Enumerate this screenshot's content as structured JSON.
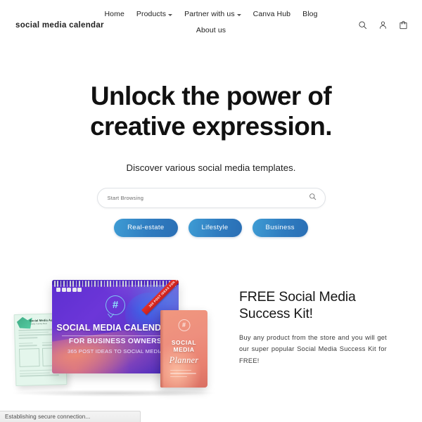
{
  "header": {
    "logo": "social media calendar",
    "nav_primary": [
      {
        "label": "Home",
        "has_dropdown": false
      },
      {
        "label": "Products",
        "has_dropdown": true
      },
      {
        "label": "Partner with us",
        "has_dropdown": true
      },
      {
        "label": "Canva Hub",
        "has_dropdown": false
      },
      {
        "label": "Blog",
        "has_dropdown": false
      }
    ],
    "nav_secondary": [
      {
        "label": "About us",
        "has_dropdown": false
      }
    ],
    "icons": [
      {
        "name": "search-icon",
        "label": "Search"
      },
      {
        "name": "account-icon",
        "label": "Account"
      },
      {
        "name": "cart-icon",
        "label": "Cart"
      }
    ]
  },
  "hero": {
    "title_line1": "Unlock the power of",
    "title_line2": "creative expression.",
    "subtitle": "Discover various social media templates.",
    "search": {
      "placeholder": "Start Browsing",
      "value": ""
    },
    "chips": [
      {
        "label": "Real-estate"
      },
      {
        "label": "Lifestyle"
      },
      {
        "label": "Business"
      }
    ]
  },
  "kit": {
    "title_line1": "FREE Social Media",
    "title_line2": "Success Kit!",
    "body": "Buy any product from the store and you will get our super popular Social Media Success Kit for FREE!",
    "calendar": {
      "title": "SOCIAL MEDIA CALENDAR",
      "subtitle": "FOR BUSINESS OWNERS",
      "tagline": "365 POST IDEAS TO SOCIAL MEDIA",
      "hash": "#",
      "ribbon": "365 POST IDEAS FOR 2022"
    },
    "planner": {
      "line1": "SOCIAL",
      "line2": "MEDIA",
      "script": "Planner",
      "hash": "#"
    },
    "audit": {
      "title": "Social Media Audit",
      "subtitle": "Monthly Tracking Sheet"
    }
  },
  "statusbar": {
    "text": "Establishing secure connection..."
  },
  "colors": {
    "chip_gradient_start": "#3e9cd4",
    "chip_gradient_end": "#2a6fb5",
    "calendar_purple": "#5d2fd0",
    "planner_coral": "#ee8f7e",
    "audit_mint": "#e4f6ec",
    "ribbon_red": "#e63027",
    "text_dark": "#111111"
  }
}
